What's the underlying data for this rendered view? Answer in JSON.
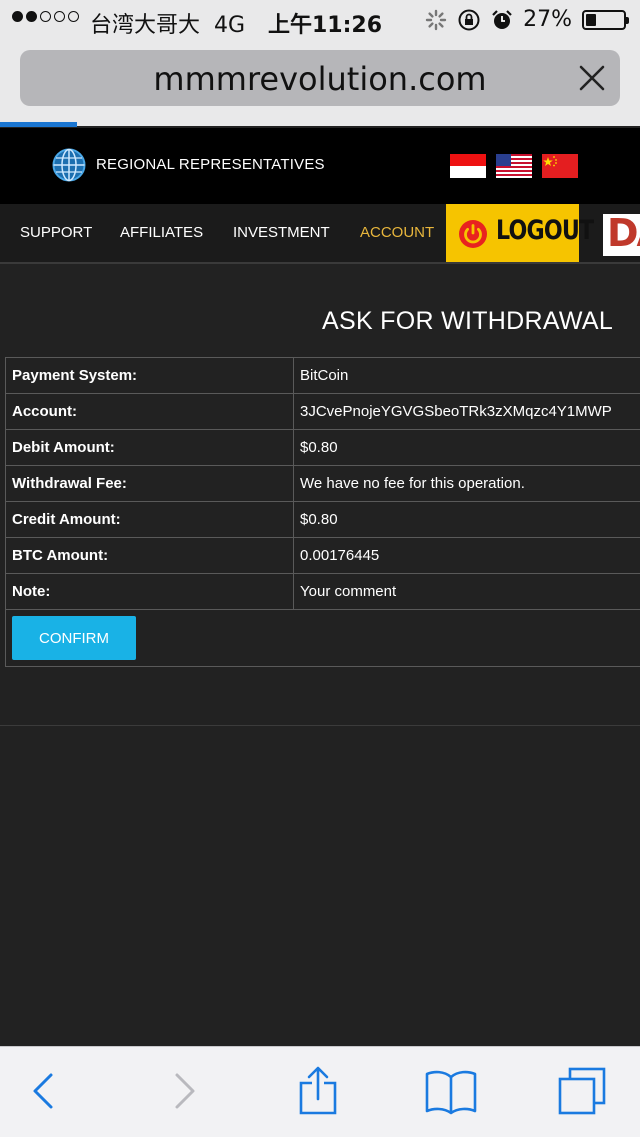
{
  "status_bar": {
    "carrier": "台湾大哥大",
    "network": "4G",
    "time": "上午11:26",
    "battery": "27%",
    "battery_level": 0.27,
    "signal_filled": 2,
    "signal_total": 5
  },
  "browser": {
    "url": "mmmrevolution.com",
    "page_load_progress": 0.12
  },
  "header": {
    "regional_label": "REGIONAL REPRESENTATIVES",
    "flags": [
      "indonesia-flag",
      "usa-flag",
      "china-flag"
    ]
  },
  "nav": {
    "support": "SUPPORT",
    "affiliates": "AFFILIATES",
    "investment": "INVESTMENT",
    "account": "ACCOUNT",
    "logout": "LOGOUT",
    "da": "DA"
  },
  "colors": {
    "accent_blue": "#19b2e6",
    "active_nav": "#e8b63c",
    "logout_yellow": "#f6c400"
  },
  "main": {
    "title": "ASK FOR WITHDRAWAL",
    "rows": [
      {
        "label": "Payment System:",
        "value": "BitCoin"
      },
      {
        "label": "Account:",
        "value": "3JCvePnojeYGVGSbeoTRk3zXMqzc4Y1MWP"
      },
      {
        "label": "Debit Amount:",
        "value": "$0.80"
      },
      {
        "label": "Withdrawal Fee:",
        "value": "We have no fee for this operation."
      },
      {
        "label": "Credit Amount:",
        "value": "$0.80"
      },
      {
        "label": "BTC Amount:",
        "value": "0.00176445"
      },
      {
        "label": "Note:",
        "value": "Your comment"
      }
    ],
    "confirm_label": "CONFIRM"
  },
  "toolbar": {
    "icons": [
      "back-icon",
      "forward-icon",
      "share-icon",
      "bookmarks-icon",
      "tabs-icon"
    ]
  }
}
